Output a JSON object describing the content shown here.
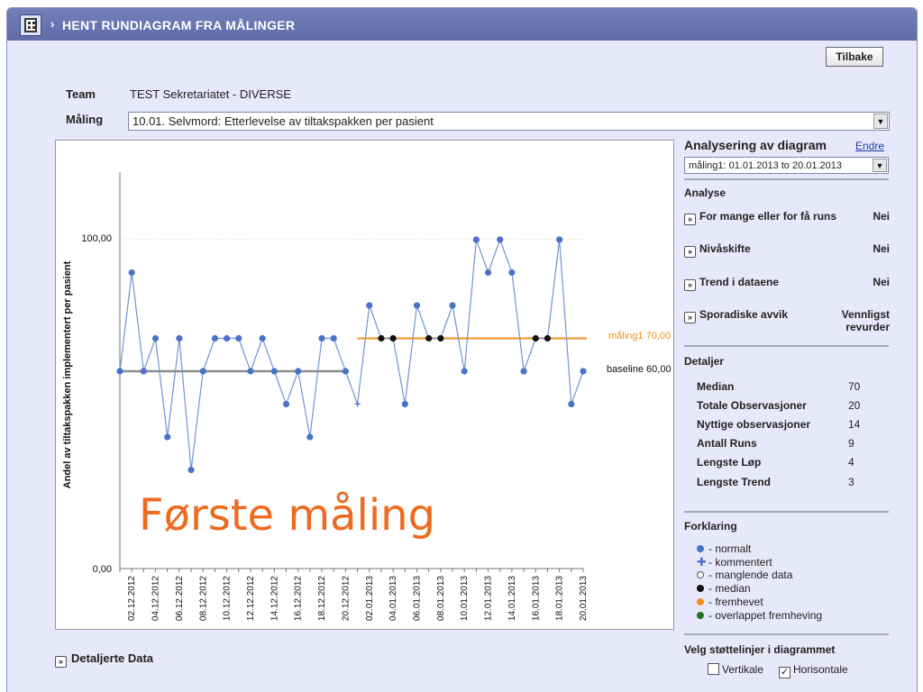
{
  "header": {
    "title": "HENT RUNDIAGRAM FRA MÅLINGER"
  },
  "buttons": {
    "back": "Tilbake"
  },
  "form": {
    "team_label": "Team",
    "team_value": "TEST Sekretariatet - DIVERSE",
    "measure_label": "Måling",
    "measure_value": "10.01. Selvmord: Etterlevelse av tiltakspakken per pasient"
  },
  "side": {
    "title": "Analysering av diagram",
    "edit_link": "Endre",
    "period_value": "måling1: 01.01.2013 to 20.01.2013",
    "analysis_heading": "Analyse",
    "analysis": [
      {
        "label": "For mange eller for få runs",
        "result": "Nei"
      },
      {
        "label": "Nivåskifte",
        "result": "Nei"
      },
      {
        "label": "Trend i dataene",
        "result": "Nei"
      },
      {
        "label": "Sporadiske avvik",
        "result": "Vennligst revurder"
      }
    ],
    "details_heading": "Detaljer",
    "details": [
      {
        "label": "Median",
        "value": "70"
      },
      {
        "label": "Totale Observasjoner",
        "value": "20"
      },
      {
        "label": "Nyttige observasjoner",
        "value": "14"
      },
      {
        "label": "Antall Runs",
        "value": "9"
      },
      {
        "label": "Lengste Løp",
        "value": "4"
      },
      {
        "label": "Lengste Trend",
        "value": "3"
      }
    ],
    "legend_heading": "Forklaring",
    "legend": [
      {
        "label": "- normalt",
        "symbol": "dot",
        "color": "#4a72c8"
      },
      {
        "label": "- kommentert",
        "symbol": "plus",
        "color": "#4a72c8"
      },
      {
        "label": "- manglende data",
        "symbol": "ring",
        "color": "#555555"
      },
      {
        "label": "- median",
        "symbol": "dot",
        "color": "#111111"
      },
      {
        "label": "- fremhevet",
        "symbol": "dot",
        "color": "#f0901e"
      },
      {
        "label": "- overlappet fremheving",
        "symbol": "dot",
        "color": "#1f7a1f"
      }
    ],
    "support_lines_heading": "Velg støttelinjer i diagrammet",
    "support_lines": {
      "vertical_label": "Vertikale",
      "vertical_checked": false,
      "horizontal_label": "Horisontale",
      "horizontal_checked": true
    }
  },
  "footer": {
    "detailed_data": "Detaljerte Data"
  },
  "colors": {
    "series": "#4a72c8",
    "line": "#7393d4",
    "baseline": "#8c8c8c",
    "median_line": "#f0901e",
    "median_point": "#111111",
    "overlay_text": "#ee6a1e",
    "titlebar": "#6672ae"
  },
  "chart_data": {
    "type": "line",
    "ylabel": "Andel av tiltakspakken implementert per pasient",
    "yticks": [
      "100,00",
      "0,00"
    ],
    "ylim": [
      0,
      100
    ],
    "x_tick_labels": [
      "02.12.2012",
      "04.12.2012",
      "06.12.2012",
      "08.12.2012",
      "10.12.2012",
      "12.12.2012",
      "14.12.2012",
      "16.12.2012",
      "18.12.2012",
      "20.12.2012",
      "02.01.2013",
      "04.01.2013",
      "06.01.2013",
      "08.01.2013",
      "10.01.2013",
      "12.01.2013",
      "14.01.2013",
      "16.01.2013",
      "18.01.2013",
      "20.01.2013"
    ],
    "overlay_text": "Første måling",
    "series": [
      {
        "name": "baseline",
        "x": [
          "01.12.2012",
          "02.12.2012",
          "03.12.2012",
          "04.12.2012",
          "05.12.2012",
          "06.12.2012",
          "07.12.2012",
          "08.12.2012",
          "09.12.2012",
          "10.12.2012",
          "11.12.2012",
          "12.12.2012",
          "13.12.2012",
          "14.12.2012",
          "15.12.2012",
          "16.12.2012",
          "17.12.2012",
          "18.12.2012",
          "19.12.2012",
          "20.12.2012"
        ],
        "values": [
          60,
          90,
          60,
          70,
          40,
          70,
          30,
          60,
          70,
          70,
          70,
          60,
          70,
          60,
          50,
          60,
          40,
          70,
          70,
          60
        ]
      },
      {
        "name": "måling1",
        "x": [
          "01.01.2013",
          "02.01.2013",
          "03.01.2013",
          "04.01.2013",
          "05.01.2013",
          "06.01.2013",
          "07.01.2013",
          "08.01.2013",
          "09.01.2013",
          "10.01.2013",
          "11.01.2013",
          "12.01.2013",
          "13.01.2013",
          "14.01.2013",
          "15.01.2013",
          "16.01.2013",
          "17.01.2013",
          "18.01.2013",
          "19.01.2013",
          "20.01.2013"
        ],
        "values": [
          50,
          80,
          70,
          70,
          50,
          80,
          70,
          70,
          80,
          60,
          100,
          90,
          100,
          90,
          60,
          70,
          70,
          100,
          50,
          60
        ],
        "commented_index": 0
      }
    ],
    "reference_lines": [
      {
        "label": "baseline 60,00",
        "value": 60,
        "from": "01.12.2012",
        "to": "20.12.2012",
        "color": "#8c8c8c"
      },
      {
        "label": "måling1 70,00",
        "value": 70,
        "from": "01.01.2013",
        "to": "20.01.2013",
        "color": "#f0901e"
      }
    ]
  }
}
